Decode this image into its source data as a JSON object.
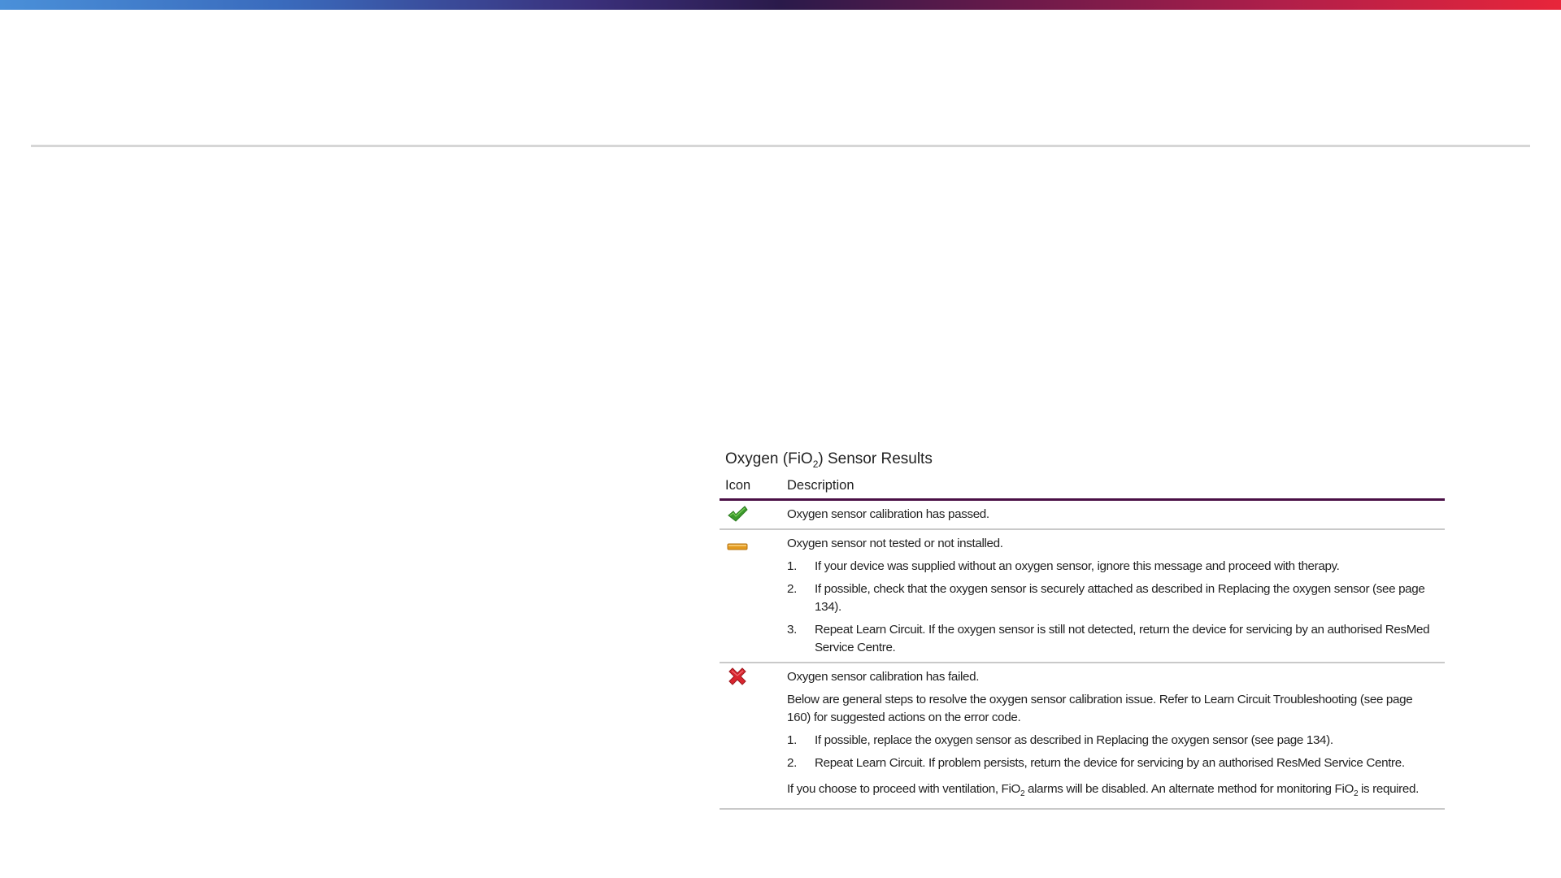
{
  "table": {
    "title_prefix": "Oxygen (FiO",
    "title_sub": "2",
    "title_suffix": ") Sensor Results",
    "header_icon": "Icon",
    "header_description": "Description",
    "rows": [
      {
        "icon": "green-checkmark-icon",
        "icon_color": "#3c9a2c",
        "summary": "Oxygen sensor calibration has passed."
      },
      {
        "icon": "orange-dash-icon",
        "icon_color": "#e39a1f",
        "summary": "Oxygen sensor not tested or not installed.",
        "steps": [
          {
            "num": "1.",
            "text": "If your device was supplied without an oxygen sensor, ignore this message and proceed with therapy."
          },
          {
            "num": "2.",
            "text": "If possible, check that the oxygen sensor is securely attached as described in Replacing the oxygen sensor (see page 134)."
          },
          {
            "num": "3.",
            "text": "Repeat Learn Circuit. If the oxygen sensor is still not detected, return the device for servicing by an authorised ResMed Service Centre."
          }
        ]
      },
      {
        "icon": "red-cross-icon",
        "icon_color": "#d9262f",
        "summary": "Oxygen sensor calibration has failed.",
        "intro": "Below are general steps to resolve the oxygen sensor calibration issue. Refer to Learn Circuit Troubleshooting (see page 160) for suggested actions on the error code.",
        "steps": [
          {
            "num": "1.",
            "text": "If possible, replace the oxygen sensor as described in Replacing the oxygen sensor (see page 134)."
          },
          {
            "num": "2.",
            "text": "Repeat Learn Circuit. If problem persists, return the device for servicing by an authorised ResMed Service Centre."
          }
        ],
        "footer_part1": "If you choose to proceed with ventilation, FiO",
        "footer_sub1": "2",
        "footer_part2": " alarms will be disabled. An alternate method for monitoring FiO",
        "footer_sub2": "2",
        "footer_part3": " is required."
      }
    ]
  }
}
